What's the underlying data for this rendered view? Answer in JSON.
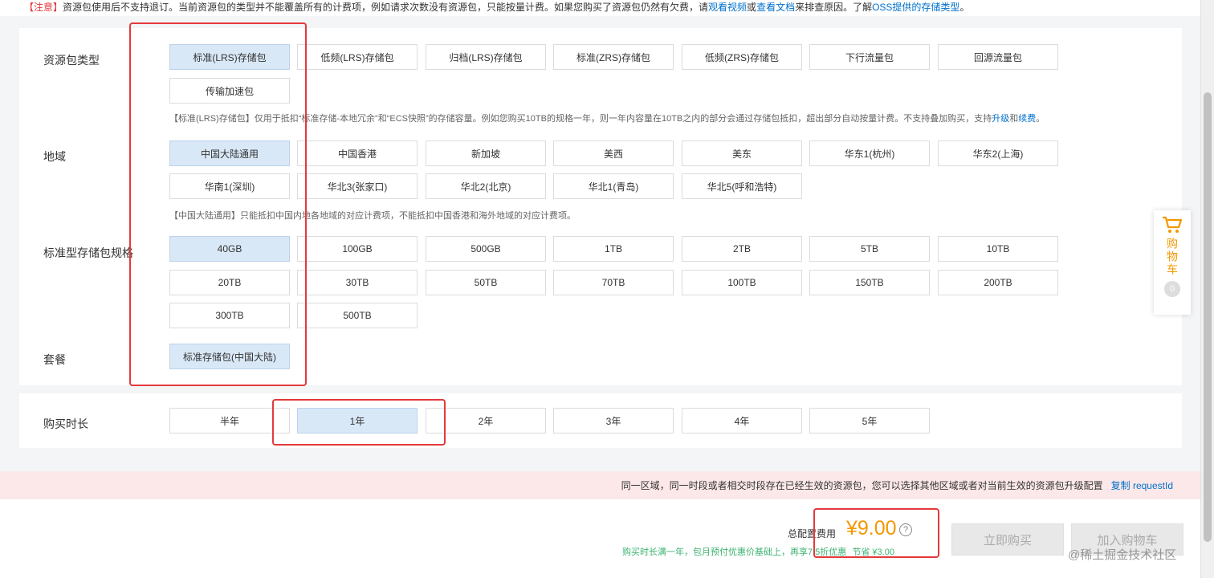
{
  "notice": {
    "tag": "【注意】",
    "text": "资源包使用后不支持退订。当前资源包的类型并不能覆盖所有的计费项，例如请求次数没有资源包，只能按量计费。如果您购买了资源包仍然有欠费，请",
    "link1": "观看视频",
    "or": "或",
    "link2": "查看文档",
    "text2": "来排查原因。了解",
    "link3": "OSS提供的存储类型",
    "end": "。"
  },
  "package_type": {
    "label": "资源包类型",
    "options": [
      "标准(LRS)存储包",
      "低频(LRS)存储包",
      "归档(LRS)存储包",
      "标准(ZRS)存储包",
      "低频(ZRS)存储包",
      "下行流量包",
      "回源流量包",
      "传输加速包"
    ],
    "desc_pre": "【标准(LRS)存储包】仅用于抵扣“标准存储-本地冗余”和“ECS快照”的存储容量。例如您购买10TB的规格一年，则一年内容量在10TB之内的部分会通过存储包抵扣，超出部分自动按量计费。不支持叠加购买，支持",
    "desc_link1": "升级",
    "desc_and": "和",
    "desc_link2": "续费",
    "desc_end": "。"
  },
  "region": {
    "label": "地域",
    "options": [
      "中国大陆通用",
      "中国香港",
      "新加坡",
      "美西",
      "美东",
      "华东1(杭州)",
      "华东2(上海)",
      "华南1(深圳)",
      "华北3(张家口)",
      "华北2(北京)",
      "华北1(青岛)",
      "华北5(呼和浩特)"
    ],
    "desc": "【中国大陆通用】只能抵扣中国内地各地域的对应计费项，不能抵扣中国香港和海外地域的对应计费项。"
  },
  "spec": {
    "label": "标准型存储包规格",
    "options": [
      "40GB",
      "100GB",
      "500GB",
      "1TB",
      "2TB",
      "5TB",
      "10TB",
      "20TB",
      "30TB",
      "50TB",
      "70TB",
      "100TB",
      "150TB",
      "200TB",
      "300TB",
      "500TB"
    ]
  },
  "plan": {
    "label": "套餐",
    "options": [
      "标准存储包(中国大陆)"
    ]
  },
  "duration": {
    "label": "购买时长",
    "options": [
      "半年",
      "1年",
      "2年",
      "3年",
      "4年",
      "5年"
    ]
  },
  "warning": {
    "text": "同一区域，同一时段或者相交时段存在已经生效的资源包，您可以选择其他区域或者对当前生效的资源包升级配置",
    "link": "复制 requestId"
  },
  "footer": {
    "total_label": "总配置费用",
    "price": "¥9.00",
    "promo": "购买时长满一年，包月预付优惠价基础上，再享7.5折优惠",
    "save_label": "节省",
    "save_value": "¥3.00",
    "buy_now": "立即购买",
    "add_cart": "加入购物车",
    "watermark": "@稀土掘金技术社区"
  },
  "cart": {
    "label": "购物车",
    "count": "0"
  },
  "colors": {
    "accent": "#0070cc",
    "price": "#f39800",
    "annotation": "#e4393c",
    "selected": "#d9e8f7"
  }
}
